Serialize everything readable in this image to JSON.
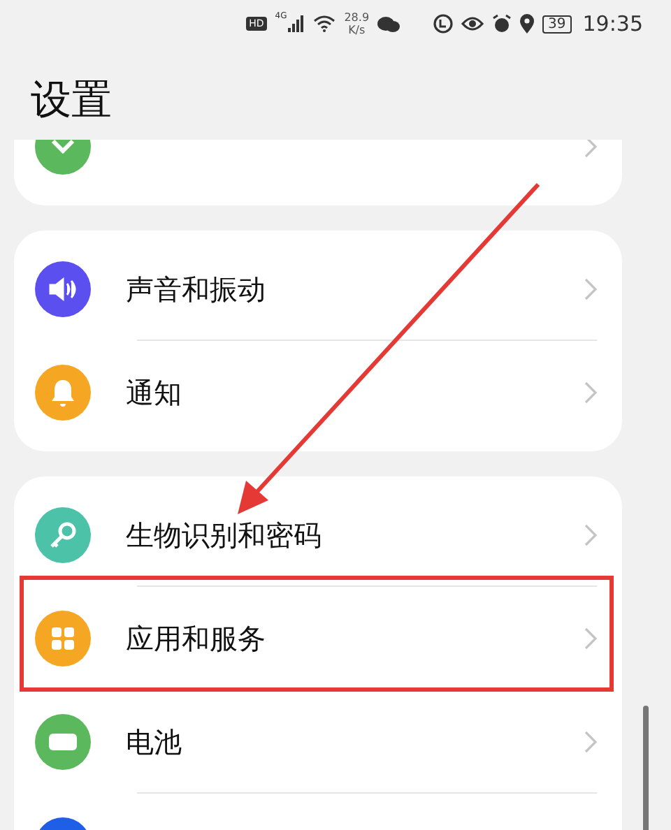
{
  "status_bar": {
    "hd": "HD",
    "network": "4G",
    "speed": "28.9",
    "speed_unit": "K/s",
    "battery": "39",
    "time": "19:35"
  },
  "title": "设置",
  "groups": [
    {
      "items": [
        {
          "kind": "display",
          "color": "#5cb85c"
        }
      ]
    },
    {
      "items": [
        {
          "label": "声音和振动",
          "kind": "sound",
          "color": "#5b4ff0"
        },
        {
          "label": "通知",
          "kind": "bell",
          "color": "#f5a623"
        }
      ]
    },
    {
      "items": [
        {
          "label": "生物识别和密码",
          "kind": "key",
          "color": "#4cc3a8"
        },
        {
          "label": "应用和服务",
          "kind": "apps",
          "color": "#f5a623",
          "highlighted": true
        },
        {
          "label": "电池",
          "kind": "battery",
          "color": "#5cb85c"
        },
        {
          "kind": "blank",
          "color": "#1f5fe8"
        }
      ]
    }
  ],
  "annotation": {
    "arrow": true
  }
}
